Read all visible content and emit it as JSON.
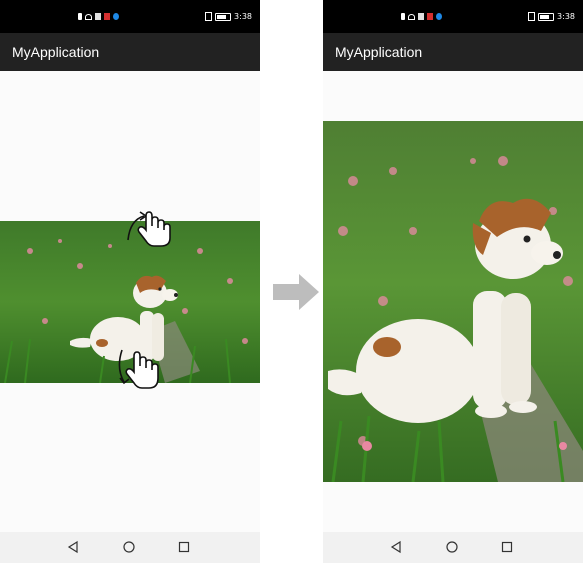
{
  "left_screen": {
    "status_time": "3:38",
    "app_title": "MyApplication"
  },
  "right_screen": {
    "status_time": "3:38",
    "app_title": "MyApplication"
  },
  "icons": {
    "gesture_top": "pinch-rotate-gesture-icon",
    "gesture_bottom": "pinch-rotate-gesture-icon",
    "transition": "right-arrow-icon",
    "nav_back": "back-triangle-icon",
    "nav_home": "home-circle-icon",
    "nav_recent": "recent-square-icon"
  },
  "colors": {
    "status_bar": "#000000",
    "app_bar": "#222222",
    "nav_bar": "#f1f1f1",
    "arrow": "#bdbdbd"
  }
}
